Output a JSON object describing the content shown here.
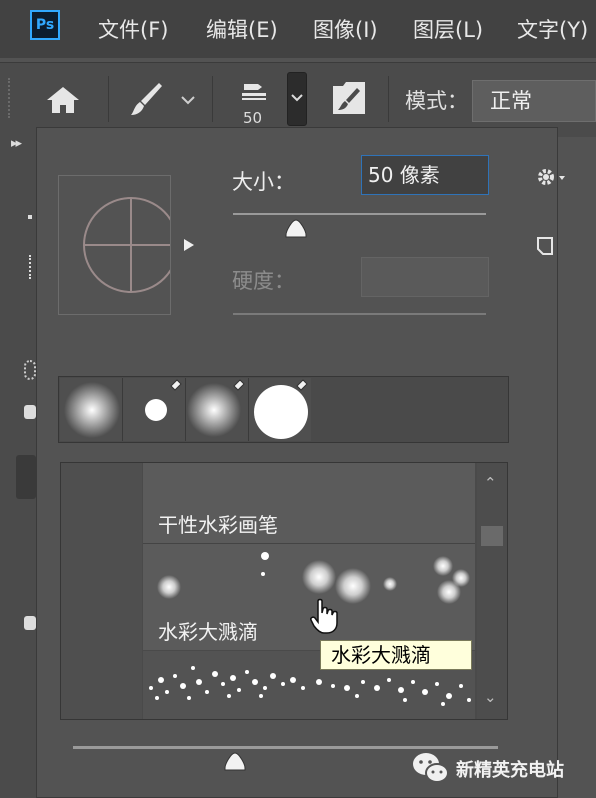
{
  "app": {
    "logo": "Ps"
  },
  "menu": [
    "文件(F)",
    "编辑(E)",
    "图像(I)",
    "图层(L)",
    "文字(Y)"
  ],
  "options_bar": {
    "brush_size_value": "50",
    "mode_label": "模式：",
    "mode_value": "正常",
    "icons": [
      "home-icon",
      "brush-tool-icon",
      "chevron-down-icon",
      "brush-preset-icon",
      "brush-settings-panel-icon"
    ]
  },
  "brush_panel": {
    "size_label": "大小：",
    "size_value": "50 像素",
    "size_slider_level": 0.25,
    "hardness_label": "硬度：",
    "hardness_value": "",
    "recent_brushes_count": 4,
    "brush_groups": [
      {
        "label": "干性水彩画笔"
      },
      {
        "label": "水彩大溅滴"
      }
    ],
    "tooltip": "水彩大溅滴",
    "preview_size_slider_level": 0.38
  },
  "watermark": {
    "text": "新精英充电站"
  },
  "colors": {
    "accent": "#31a8ff",
    "panel": "#535353",
    "tooltip_bg": "#ffffdc"
  }
}
